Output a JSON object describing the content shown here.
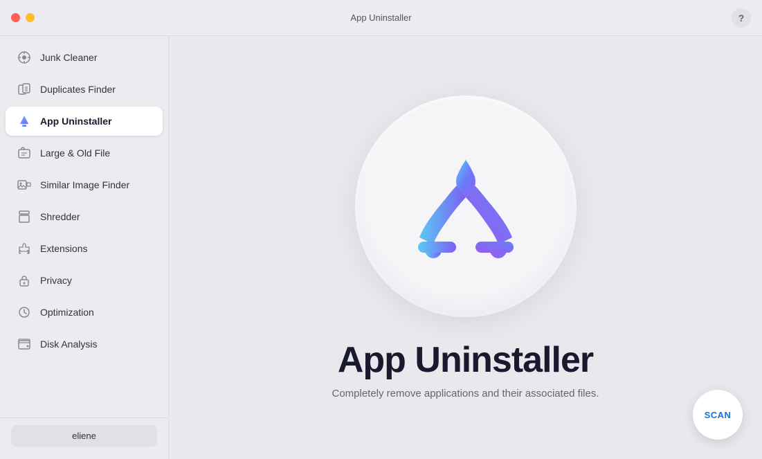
{
  "titlebar": {
    "app_name": "App Uninstaller",
    "help_label": "?"
  },
  "sidebar": {
    "items": [
      {
        "id": "junk-cleaner",
        "label": "Junk Cleaner",
        "icon": "junk",
        "active": false
      },
      {
        "id": "duplicates-finder",
        "label": "Duplicates Finder",
        "icon": "duplicates",
        "active": false
      },
      {
        "id": "app-uninstaller",
        "label": "App Uninstaller",
        "icon": "app",
        "active": true
      },
      {
        "id": "large-old-file",
        "label": "Large & Old File",
        "icon": "large",
        "active": false
      },
      {
        "id": "similar-image-finder",
        "label": "Similar Image Finder",
        "icon": "image",
        "active": false
      },
      {
        "id": "shredder",
        "label": "Shredder",
        "icon": "shredder",
        "active": false
      },
      {
        "id": "extensions",
        "label": "Extensions",
        "icon": "extensions",
        "active": false
      },
      {
        "id": "privacy",
        "label": "Privacy",
        "icon": "privacy",
        "active": false
      },
      {
        "id": "optimization",
        "label": "Optimization",
        "icon": "optimization",
        "active": false
      },
      {
        "id": "disk-analysis",
        "label": "Disk Analysis",
        "icon": "disk",
        "active": false
      }
    ],
    "user_label": "eliene"
  },
  "content": {
    "title": "App Uninstaller",
    "subtitle": "Completely remove applications and their associated files.",
    "scan_label": "SCAN"
  }
}
